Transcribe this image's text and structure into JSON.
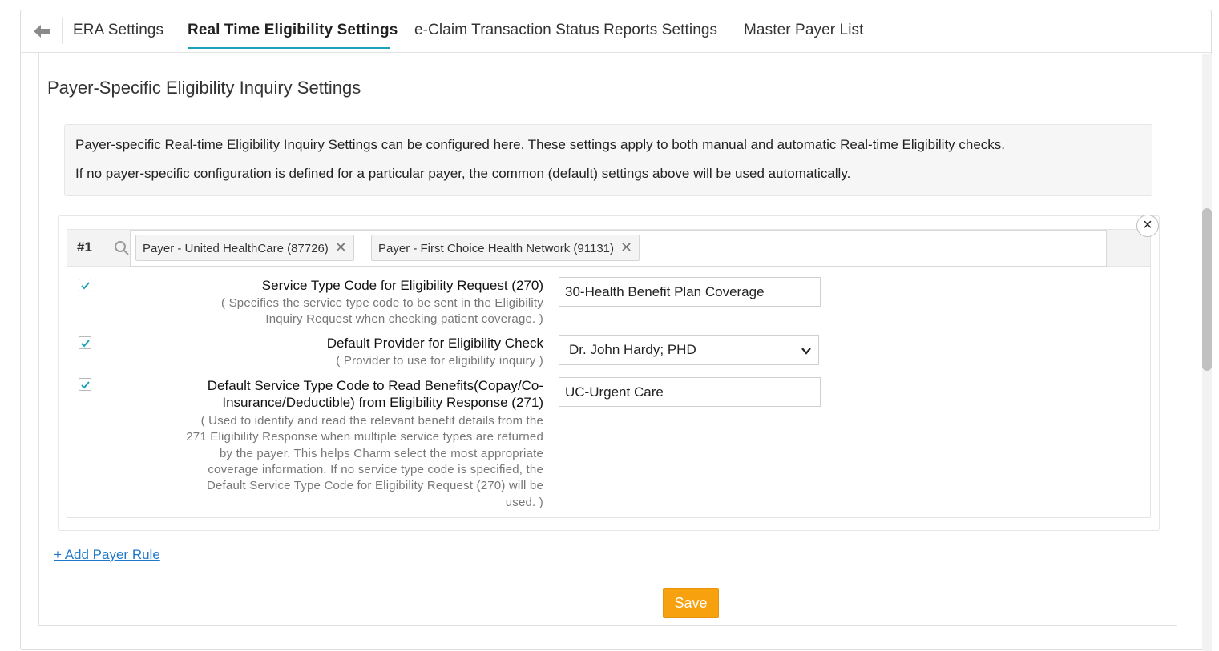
{
  "tabs": [
    {
      "label": "ERA Settings"
    },
    {
      "label": "Real Time Eligibility Settings",
      "active": true
    },
    {
      "label": "e-Claim Transaction Status Reports Settings"
    },
    {
      "label": "Master Payer List"
    }
  ],
  "icons": {
    "back": "arrow-left-icon",
    "search": "search-icon",
    "close": "close-icon",
    "check": "check-icon",
    "chevron": "chevron-down-icon"
  },
  "colors": {
    "accent_underline": "#1aa3b5",
    "checkbox_check": "#1aa3b5",
    "link": "#1f78c8",
    "save_button": "#f8a10e"
  },
  "section": {
    "title": "Payer-Specific Eligibility Inquiry Settings"
  },
  "info": {
    "line1": "Payer-specific Real-time Eligibility Inquiry Settings can be configured here. These settings apply to both manual and automatic Real-time Eligibility checks.",
    "line2": "If no payer-specific configuration is defined for a particular payer, the common (default) settings above will be used automatically."
  },
  "rule": {
    "number": "#1",
    "payers": [
      {
        "label": "Payer - United HealthCare (87726)",
        "remove": "✕"
      },
      {
        "label": "Payer - First Choice Health Network (91131)",
        "remove": "✕"
      }
    ],
    "close_glyph": "×",
    "fields": [
      {
        "checked": true,
        "label": "Service Type Code for Eligibility Request (270)",
        "help_lines": [
          "( Specifies the service type code to be sent in the Eligibility",
          "Inquiry Request when checking patient coverage. )"
        ],
        "value": "30-Health Benefit Plan Coverage"
      },
      {
        "checked": true,
        "label": "Default Provider for Eligibility Check",
        "help_lines": [
          "( Provider to use for eligibility inquiry )"
        ],
        "selected": "Dr. John Hardy; PHD"
      },
      {
        "checked": true,
        "label_lines": [
          "Default Service Type Code to Read Benefits(Copay/Co-",
          "Insurance/Deductible) from Eligibility Response (271)"
        ],
        "help_lines": [
          "( Used to identify and read the relevant benefit details from the",
          "271 Eligibility Response when multiple service types are returned",
          "by the payer. This helps Charm select the most appropriate",
          "coverage information. If no service type code is specified, the",
          "Default Service Type Code for Eligibility Request (270) will be",
          "used. )"
        ],
        "value": "UC-Urgent Care"
      }
    ]
  },
  "actions": {
    "add_rule": "+ Add Payer Rule",
    "save": "Save"
  }
}
